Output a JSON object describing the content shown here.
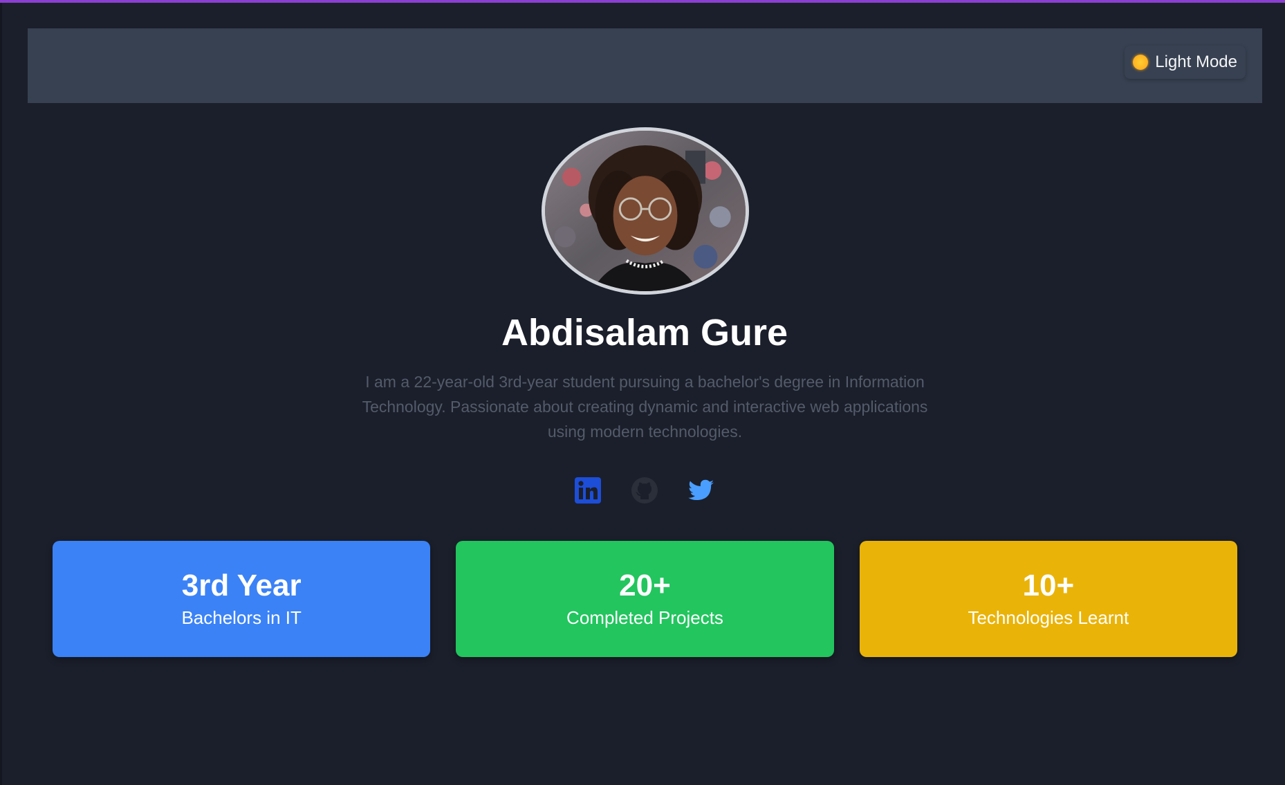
{
  "colors": {
    "page_bg": "#1b1f2b",
    "header_bg": "#374151",
    "accent_top": "#8b3fd1",
    "card_blue": "#3b82f6",
    "card_green": "#22c55e",
    "card_yellow": "#eab308"
  },
  "header": {
    "theme_toggle": {
      "icon": "sun-icon",
      "label": "Light Mode"
    }
  },
  "profile": {
    "avatar": "profile-photo",
    "name": "Abdisalam Gure",
    "bio": "I am a 22-year-old 3rd-year student pursuing a bachelor's degree in Information Technology. Passionate about creating dynamic and interactive web applications using modern technologies."
  },
  "socials": [
    {
      "icon": "linkedin-icon",
      "color": "#1d4ed8"
    },
    {
      "icon": "github-icon",
      "color": "#2a2f3a"
    },
    {
      "icon": "twitter-icon",
      "color": "#4a9eff"
    }
  ],
  "stats": [
    {
      "value": "3rd Year",
      "label": "Bachelors in IT",
      "color": "#3b82f6"
    },
    {
      "value": "20+",
      "label": "Completed Projects",
      "color": "#22c55e"
    },
    {
      "value": "10+",
      "label": "Technologies Learnt",
      "color": "#eab308"
    }
  ]
}
